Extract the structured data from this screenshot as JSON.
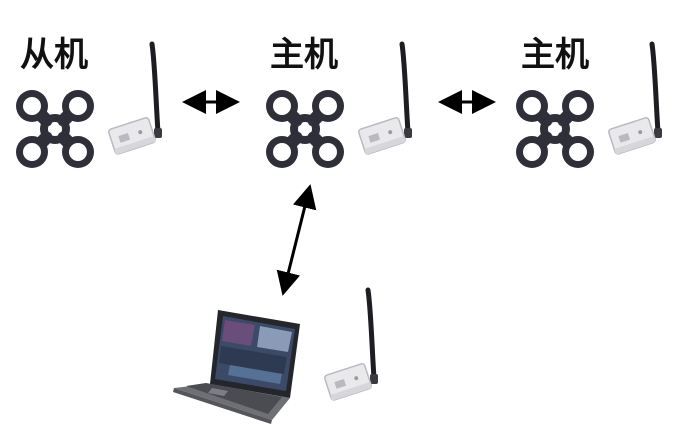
{
  "labels": {
    "left": "从机",
    "middle": "主机",
    "right": "主机"
  },
  "colors": {
    "drone_body": "#2f2f3a",
    "drone_center": "#ffffff",
    "radio_box": "#e9e9ec",
    "radio_edge": "#b9b9c1",
    "antenna": "#1d1d22",
    "arrow": "#000000",
    "laptop_base": "#6f7076",
    "laptop_bezel": "#25262b"
  },
  "nodes": [
    {
      "role": "slave-drone",
      "icon": "drone-icon"
    },
    {
      "role": "master-drone",
      "icon": "drone-icon"
    },
    {
      "role": "master-drone",
      "icon": "drone-icon"
    },
    {
      "role": "ground-station",
      "icon": "laptop-icon"
    }
  ]
}
